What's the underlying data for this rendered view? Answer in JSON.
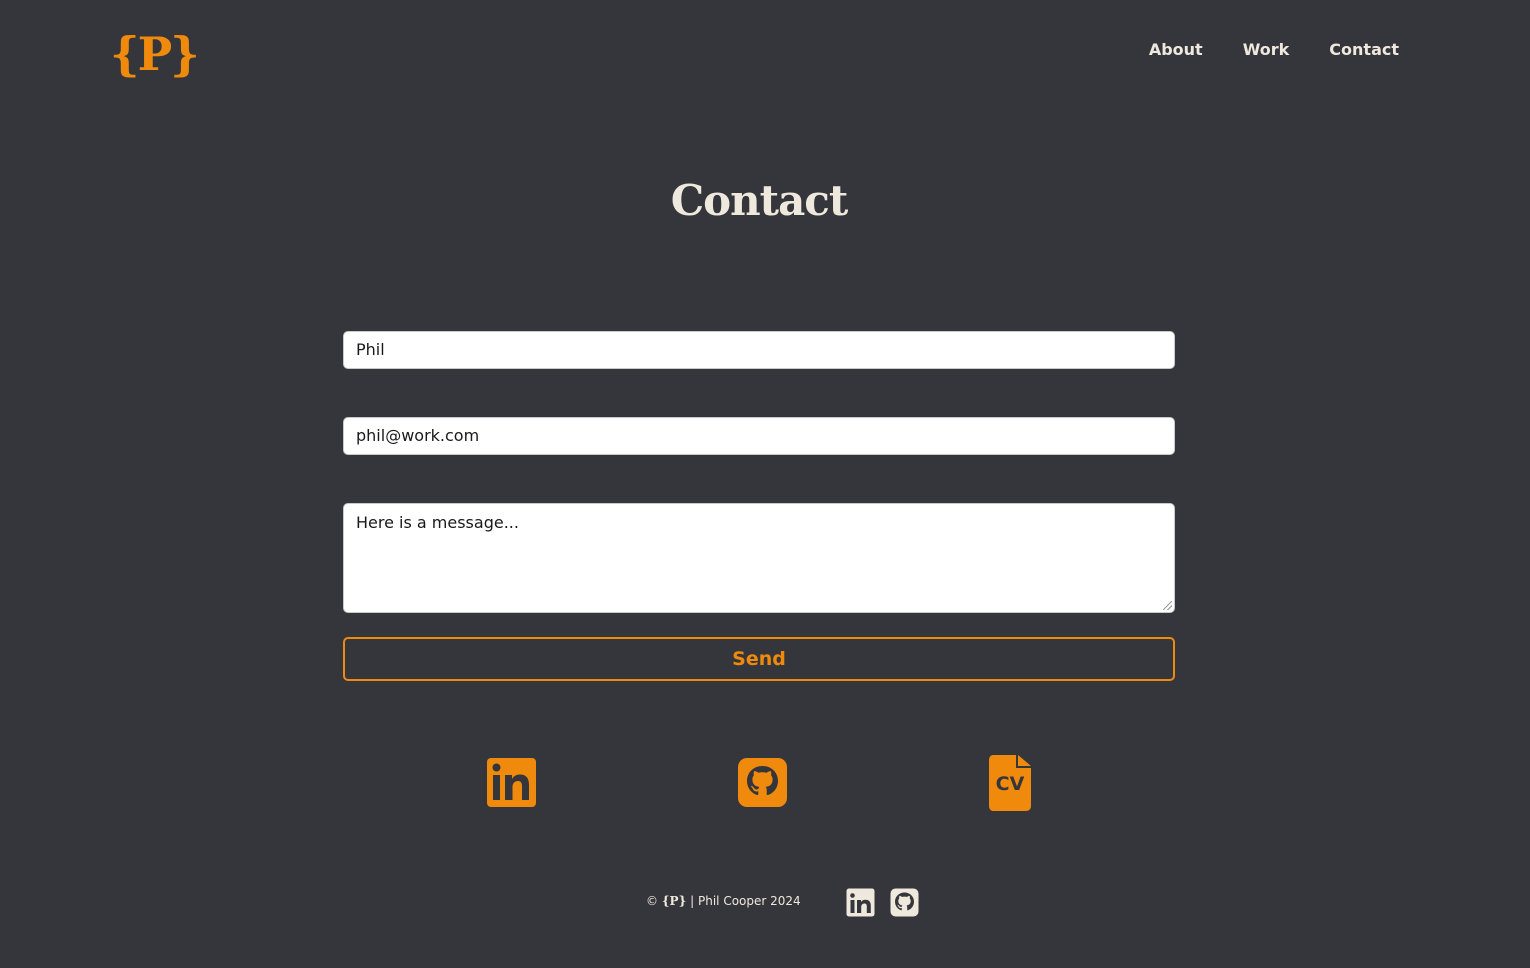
{
  "header": {
    "logo_text": "{P}",
    "nav": [
      {
        "label": "About"
      },
      {
        "label": "Work"
      },
      {
        "label": "Contact"
      }
    ]
  },
  "main": {
    "title": "Contact",
    "form": {
      "name_value": "Phil",
      "email_value": "phil@work.com",
      "message_value": "Here is a message...",
      "send_label": "Send"
    },
    "social_icons": [
      "linkedin-icon",
      "github-icon",
      "cv-document-icon"
    ],
    "cv_icon_text": "CV"
  },
  "footer": {
    "copyright_symbol": "©",
    "logo_text": "{P}",
    "separator": "|",
    "credit": "Phil Cooper 2024",
    "icons": [
      "linkedin-icon",
      "github-icon"
    ]
  },
  "colors": {
    "background": "#35363c",
    "accent": "#ef8a0c",
    "text_light": "#efe8dc"
  }
}
